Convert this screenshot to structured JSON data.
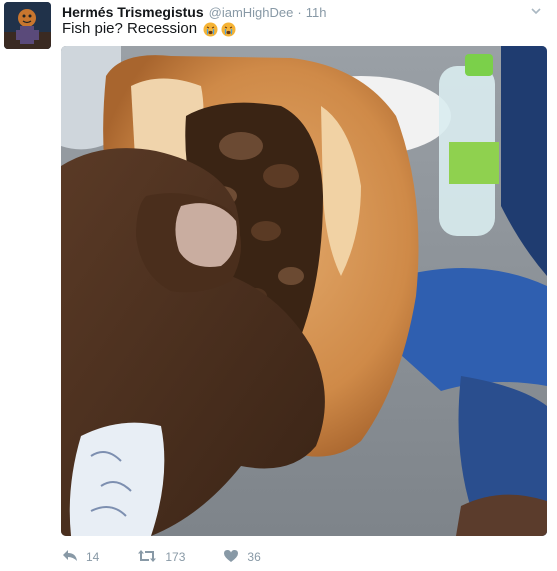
{
  "tweet": {
    "display_name": "Hermés Trismegistus",
    "handle": "@iamHighDee",
    "separator": "·",
    "timestamp": "11h",
    "text": "Fish pie? Recession",
    "emojis": [
      "crying-face-icon",
      "crying-face-icon"
    ]
  },
  "actions": {
    "reply_count": "14",
    "retweet_count": "173",
    "like_count": "36"
  },
  "colors": {
    "text": "#14171a",
    "muted": "#8899a6"
  }
}
